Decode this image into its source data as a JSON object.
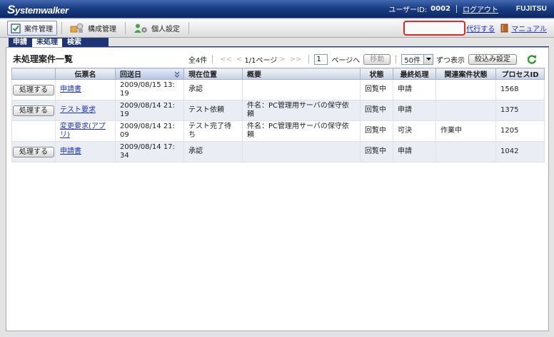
{
  "colors": {
    "header_bg": "#1c3e86",
    "link": "#1d36b8",
    "highlight": "#d92b25",
    "row_alt": "#eaedf4",
    "refresh": "#2f9a2f",
    "subtab_bg": "#1d3574"
  },
  "header": {
    "logo": "Systemwalker",
    "user_id_label": "ユーザーID:",
    "user_id": "0002",
    "logout": "ログアウト",
    "brand": "FUJITSU"
  },
  "toolbar": {
    "tabs": [
      {
        "label": "案件管理",
        "icon": "checklist-icon",
        "active": true
      },
      {
        "label": "構成管理",
        "icon": "configuration-icon",
        "active": false
      },
      {
        "label": "個人設定",
        "icon": "personal-settings-icon",
        "active": false
      }
    ],
    "proxy_link": "代行する",
    "manual_icon": "manual-book-icon",
    "manual_link": "マニュアル"
  },
  "subtabs": [
    {
      "label": "申請",
      "active": false
    },
    {
      "label": "未処理",
      "active": true
    },
    {
      "label": "検索",
      "active": false
    }
  ],
  "list": {
    "title": "未処理案件一覧",
    "pagination": {
      "total": "全4件",
      "first": "<<",
      "prev": "<",
      "page": "1/1ページ",
      "next": ">",
      "last": ">>",
      "page_input": "1",
      "goto_label": "ページへ",
      "move_button": "移動",
      "per_page": "50件",
      "per_page_suffix": "ずつ表示",
      "filter_button": "絞込み設定",
      "refresh_icon": "refresh-icon"
    },
    "columns": [
      {
        "label": "伝票名",
        "sorted": false
      },
      {
        "label": "回送日",
        "sorted": true
      },
      {
        "label": "現在位置",
        "sorted": false
      },
      {
        "label": "概要",
        "sorted": false
      },
      {
        "label": "状態",
        "sorted": false
      },
      {
        "label": "最終処理",
        "sorted": false
      },
      {
        "label": "関連案件状態",
        "sorted": false
      },
      {
        "label": "プロセスID",
        "sorted": false
      }
    ],
    "rows": [
      {
        "action": "処理する",
        "name": "申請書",
        "date": "2009/08/15 13:19",
        "position": "承認",
        "status": "回覧中",
        "last_action": "申請",
        "process_id": "1568"
      },
      {
        "action": "処理する",
        "name": "テスト要求",
        "date": "2009/08/14 21:19",
        "position": "テスト依頼",
        "summary": "件名：PC管理用サーバの保守依頼",
        "status": "回覧中",
        "last_action": "申請",
        "process_id": "1375"
      },
      {
        "name": "変更要求(アプリ)",
        "date": "2009/08/14 21:09",
        "position": "テスト完了待ち",
        "summary": "件名：PC管理用サーバの保守依頼",
        "status": "回覧中",
        "last_action": "可決",
        "related_status": "作業中",
        "process_id": "1205"
      },
      {
        "action": "処理する",
        "name": "申請書",
        "date": "2009/08/14 17:34",
        "position": "承認",
        "status": "回覧中",
        "last_action": "申請",
        "process_id": "1042"
      }
    ]
  }
}
